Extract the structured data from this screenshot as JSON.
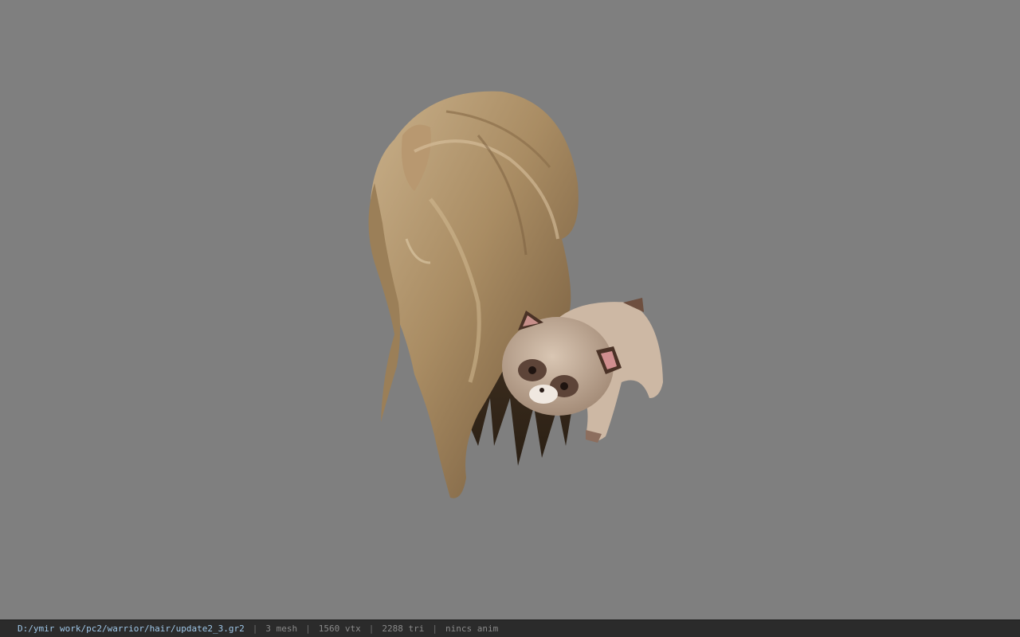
{
  "viewer": {
    "background_color": "#7f7f7f",
    "model_description": "3D hair model with a raccoon plush accessory"
  },
  "status_bar": {
    "file_path": "D:/ymir work/pc2/warrior/hair/update2_3.gr2",
    "mesh_count": "3 mesh",
    "vertex_count": "1560 vtx",
    "triangle_count": "2288 tri",
    "anim_status": "nincs anim",
    "separator": "|"
  },
  "colors": {
    "path_text": "#9fc7e8",
    "info_text": "#8a8a8a",
    "bar_bg": "#2b2b2b"
  }
}
